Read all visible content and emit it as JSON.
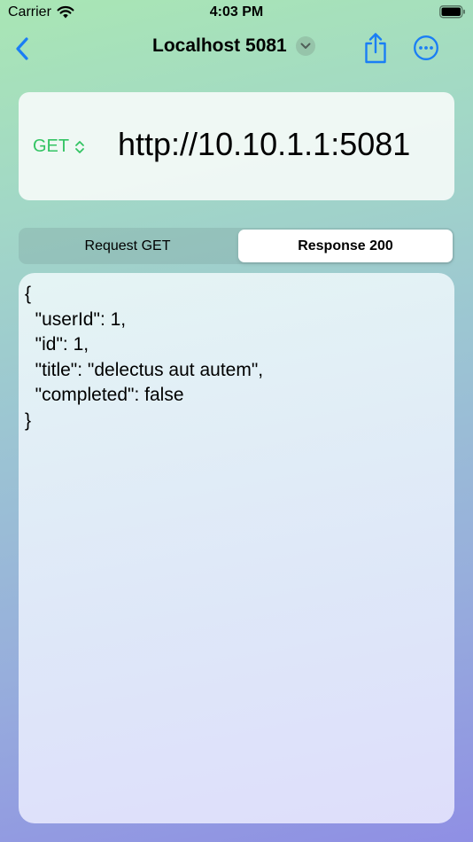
{
  "status_bar": {
    "carrier": "Carrier",
    "time": "4:03 PM",
    "icons": [
      "wifi-icon",
      "battery-icon"
    ]
  },
  "nav": {
    "title": "Localhost 5081",
    "icons": [
      "chevron-left-icon",
      "chevron-down-icon",
      "share-icon",
      "ellipsis-circle-icon"
    ],
    "accent_color": "#1a7ef5"
  },
  "request": {
    "method": "GET",
    "method_color": "#33c463",
    "url": "http://10.10.1.1:5081"
  },
  "tabs": [
    {
      "label": "Request GET",
      "selected": false
    },
    {
      "label": "Response 200",
      "selected": true
    }
  ],
  "response": {
    "lines": [
      "{",
      "  \"userId\": 1,",
      "  \"id\": 1,",
      "  \"title\": \"delectus aut autem\",",
      "  \"completed\": false",
      "}"
    ]
  }
}
